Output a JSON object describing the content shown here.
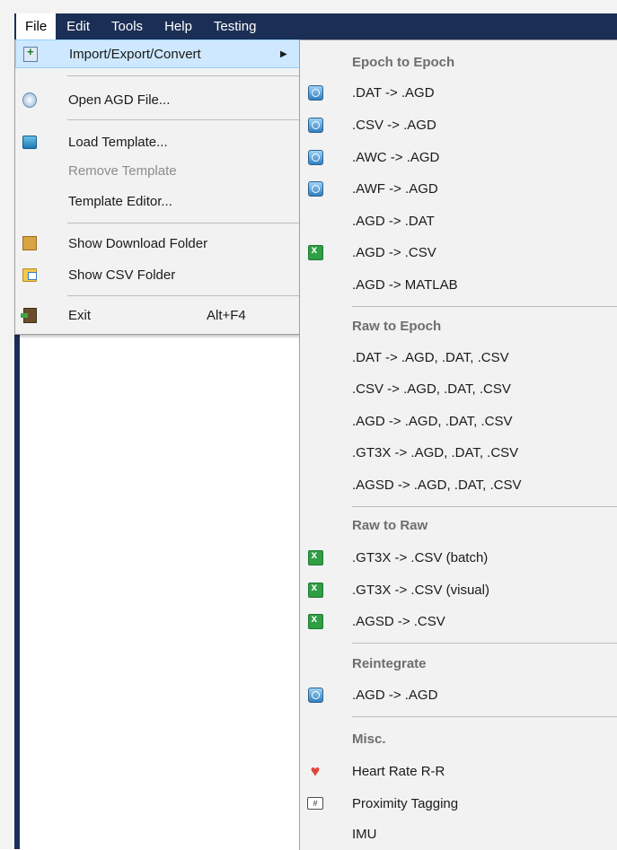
{
  "menubar": {
    "items": [
      {
        "label": "File",
        "active": true
      },
      {
        "label": "Edit"
      },
      {
        "label": "Tools"
      },
      {
        "label": "Help"
      },
      {
        "label": "Testing"
      }
    ]
  },
  "file_menu": {
    "import_export": {
      "label": "Import/Export/Convert",
      "icon": "import-icon"
    },
    "open_agd": {
      "label": "Open AGD File...",
      "icon": "magnifier-icon"
    },
    "load_template": {
      "label": "Load Template...",
      "icon": "template-icon"
    },
    "remove_template": {
      "label": "Remove Template",
      "disabled": true
    },
    "template_editor": {
      "label": "Template Editor..."
    },
    "show_download": {
      "label": "Show Download Folder",
      "icon": "box-icon"
    },
    "show_csv": {
      "label": "Show CSV Folder",
      "icon": "folder-icon"
    },
    "exit": {
      "label": "Exit",
      "shortcut": "Alt+F4",
      "icon": "exit-icon"
    }
  },
  "submenu": {
    "epoch_to_epoch": {
      "header": "Epoch to Epoch",
      "items": [
        {
          "label": ".DAT -> .AGD",
          "icon": "globe-icon"
        },
        {
          "label": ".CSV -> .AGD",
          "icon": "globe-icon"
        },
        {
          "label": ".AWC -> .AGD",
          "icon": "globe-icon"
        },
        {
          "label": ".AWF -> .AGD",
          "icon": "globe-icon"
        },
        {
          "label": ".AGD -> .DAT",
          "icon": ""
        },
        {
          "label": ".AGD -> .CSV",
          "icon": "excel-icon"
        },
        {
          "label": ".AGD -> MATLAB",
          "icon": ""
        }
      ]
    },
    "raw_to_epoch": {
      "header": "Raw to Epoch",
      "items": [
        {
          "label": ".DAT -> .AGD, .DAT, .CSV"
        },
        {
          "label": ".CSV -> .AGD, .DAT, .CSV"
        },
        {
          "label": ".AGD -> .AGD, .DAT, .CSV"
        },
        {
          "label": ".GT3X -> .AGD, .DAT, .CSV"
        },
        {
          "label": ".AGSD -> .AGD, .DAT, .CSV"
        }
      ]
    },
    "raw_to_raw": {
      "header": "Raw to Raw",
      "items": [
        {
          "label": ".GT3X -> .CSV (batch)",
          "icon": "excel-icon"
        },
        {
          "label": ".GT3X -> .CSV (visual)",
          "icon": "excel-icon"
        },
        {
          "label": ".AGSD -> .CSV",
          "icon": "excel-icon"
        }
      ]
    },
    "reintegrate": {
      "header": "Reintegrate",
      "items": [
        {
          "label": ".AGD -> .AGD",
          "icon": "globe-icon"
        }
      ]
    },
    "misc": {
      "header": "Misc.",
      "items": [
        {
          "label": "Heart Rate R-R",
          "icon": "heart-icon"
        },
        {
          "label": "Proximity Tagging",
          "icon": "tag-icon"
        },
        {
          "label": "IMU",
          "icon": ""
        }
      ]
    }
  }
}
